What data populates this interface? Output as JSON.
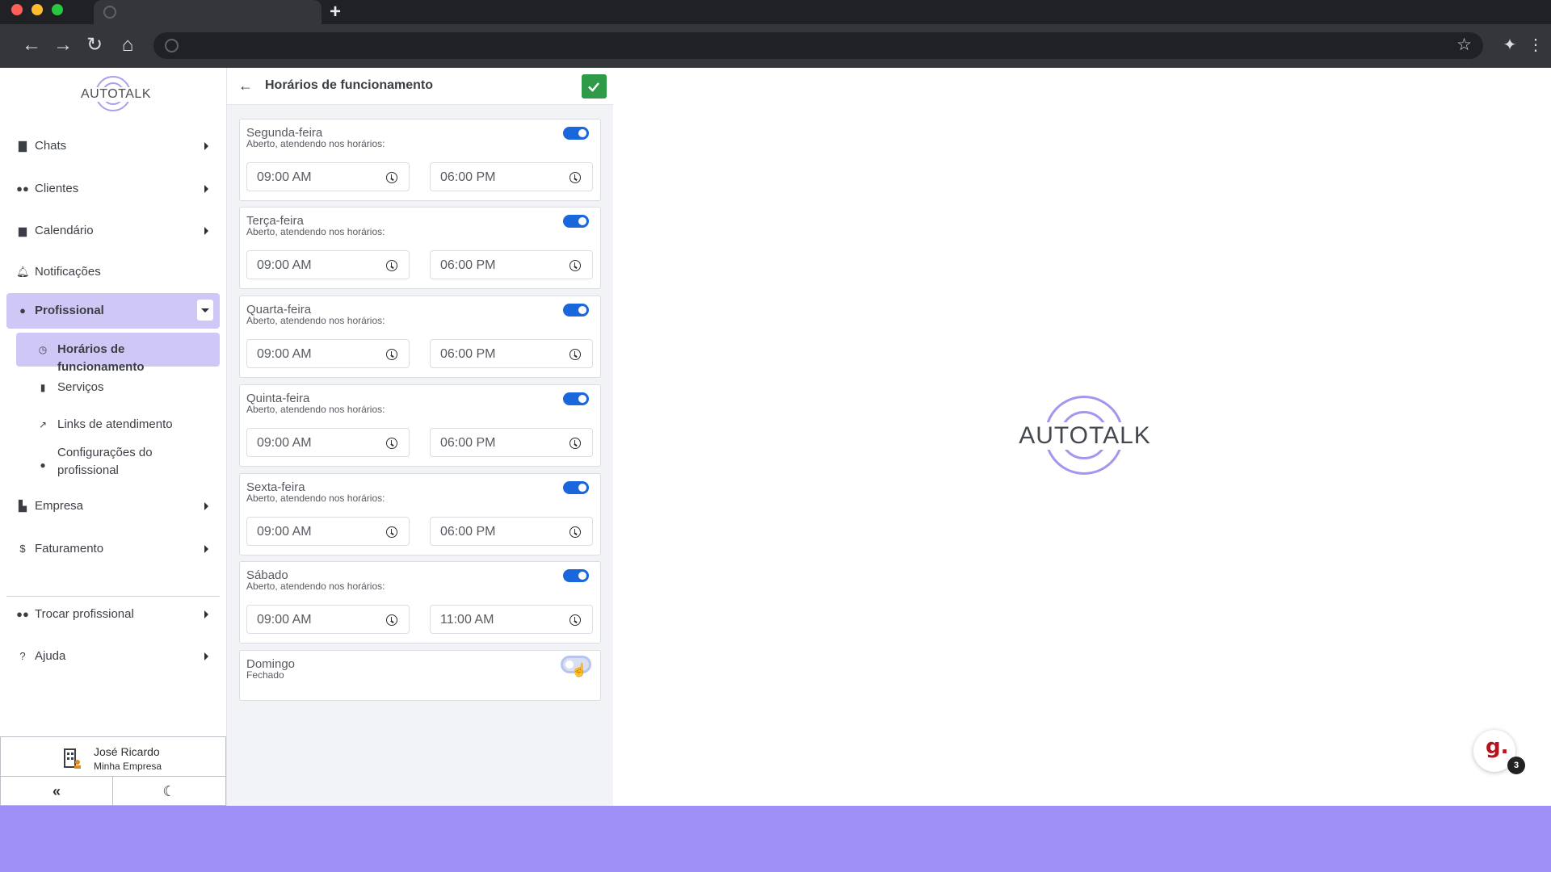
{
  "browser": {
    "new_tab_label": "+",
    "colors": {
      "close": "#ff5f57",
      "minimize": "#febc2e",
      "maximize": "#28c840"
    }
  },
  "sidebar": {
    "logo_text": "AUTOTALK",
    "items": [
      {
        "label": "Chats",
        "icon": "chat-icon"
      },
      {
        "label": "Clientes",
        "icon": "users-icon"
      },
      {
        "label": "Calendário",
        "icon": "calendar-icon"
      },
      {
        "label": "Notificações",
        "icon": "bell-icon"
      },
      {
        "label": "Profissional",
        "icon": "user-cog-icon"
      },
      {
        "label": "Empresa",
        "icon": "building-icon"
      },
      {
        "label": "Faturamento",
        "icon": "dollar-icon"
      },
      {
        "label": "Trocar profissional",
        "icon": "users-swap-icon"
      },
      {
        "label": "Ajuda",
        "icon": "help-icon"
      }
    ],
    "sub_items": [
      {
        "label": "Horários de funcionamento",
        "icon": "clock-icon"
      },
      {
        "label": "Serviços",
        "icon": "clipboard-icon"
      },
      {
        "label": "Links de atendimento",
        "icon": "external-link-icon"
      },
      {
        "label": "Configurações do profissional",
        "icon": "user-cog-icon"
      }
    ],
    "user": {
      "name": "José Ricardo",
      "company": "Minha Empresa"
    }
  },
  "panel": {
    "title": "Horários de funcionamento",
    "days": [
      {
        "name": "Segunda-feira",
        "status": "Aberto, atendendo nos horários:",
        "open": true,
        "start": "09:00 AM",
        "end": "06:00 PM"
      },
      {
        "name": "Terça-feira",
        "status": "Aberto, atendendo nos horários:",
        "open": true,
        "start": "09:00 AM",
        "end": "06:00 PM"
      },
      {
        "name": "Quarta-feira",
        "status": "Aberto, atendendo nos horários:",
        "open": true,
        "start": "09:00 AM",
        "end": "06:00 PM"
      },
      {
        "name": "Quinta-feira",
        "status": "Aberto, atendendo nos horários:",
        "open": true,
        "start": "09:00 AM",
        "end": "06:00 PM"
      },
      {
        "name": "Sexta-feira",
        "status": "Aberto, atendendo nos horários:",
        "open": true,
        "start": "09:00 AM",
        "end": "06:00 PM"
      },
      {
        "name": "Sábado",
        "status": "Aberto, atendendo nos horários:",
        "open": true,
        "start": "09:00 AM",
        "end": "11:00 AM"
      },
      {
        "name": "Domingo",
        "status": "Fechado",
        "open": false
      }
    ]
  },
  "main": {
    "logo_text": "AUTOTALK"
  },
  "widget": {
    "letter": "g.",
    "badge_count": "3"
  },
  "colors": {
    "accent": "#cfc8f7",
    "toggle_on": "#1a66dd",
    "confirm": "#2f9a48",
    "band": "#9e8ff7"
  }
}
